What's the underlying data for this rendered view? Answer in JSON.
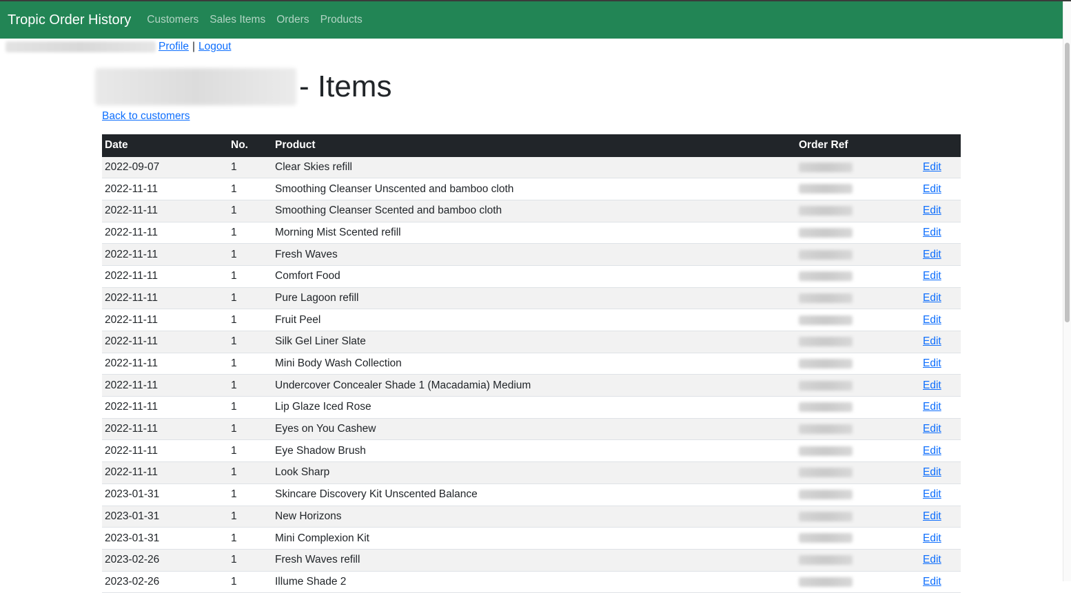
{
  "navbar": {
    "brand": "Tropic Order History",
    "links": [
      "Customers",
      "Sales Items",
      "Orders",
      "Products"
    ]
  },
  "userbar": {
    "profile": "Profile",
    "separator": "|",
    "logout": "Logout"
  },
  "page": {
    "title_suffix": "- Items",
    "back_link": "Back to customers"
  },
  "table": {
    "headers": [
      "Date",
      "No.",
      "Product",
      "Order Ref",
      ""
    ],
    "edit_label": "Edit",
    "rows": [
      {
        "date": "2022-09-07",
        "no": "1",
        "product": "Clear Skies refill"
      },
      {
        "date": "2022-11-11",
        "no": "1",
        "product": "Smoothing Cleanser Unscented and bamboo cloth"
      },
      {
        "date": "2022-11-11",
        "no": "1",
        "product": "Smoothing Cleanser Scented and bamboo cloth"
      },
      {
        "date": "2022-11-11",
        "no": "1",
        "product": "Morning Mist Scented refill"
      },
      {
        "date": "2022-11-11",
        "no": "1",
        "product": "Fresh Waves"
      },
      {
        "date": "2022-11-11",
        "no": "1",
        "product": "Comfort Food"
      },
      {
        "date": "2022-11-11",
        "no": "1",
        "product": "Pure Lagoon refill"
      },
      {
        "date": "2022-11-11",
        "no": "1",
        "product": "Fruit Peel"
      },
      {
        "date": "2022-11-11",
        "no": "1",
        "product": "Silk Gel Liner Slate"
      },
      {
        "date": "2022-11-11",
        "no": "1",
        "product": "Mini Body Wash Collection"
      },
      {
        "date": "2022-11-11",
        "no": "1",
        "product": "Undercover Concealer Shade 1 (Macadamia) Medium"
      },
      {
        "date": "2022-11-11",
        "no": "1",
        "product": "Lip Glaze Iced Rose"
      },
      {
        "date": "2022-11-11",
        "no": "1",
        "product": "Eyes on You Cashew"
      },
      {
        "date": "2022-11-11",
        "no": "1",
        "product": "Eye Shadow Brush"
      },
      {
        "date": "2022-11-11",
        "no": "1",
        "product": "Look Sharp"
      },
      {
        "date": "2023-01-31",
        "no": "1",
        "product": "Skincare Discovery Kit Unscented Balance"
      },
      {
        "date": "2023-01-31",
        "no": "1",
        "product": "New Horizons"
      },
      {
        "date": "2023-01-31",
        "no": "1",
        "product": "Mini Complexion Kit"
      },
      {
        "date": "2023-02-26",
        "no": "1",
        "product": "Fresh Waves refill"
      },
      {
        "date": "2023-02-26",
        "no": "1",
        "product": "Illume Shade 2"
      }
    ]
  },
  "colors": {
    "navbar": "#228555",
    "table_header": "#212529",
    "link": "#0d6efd"
  }
}
